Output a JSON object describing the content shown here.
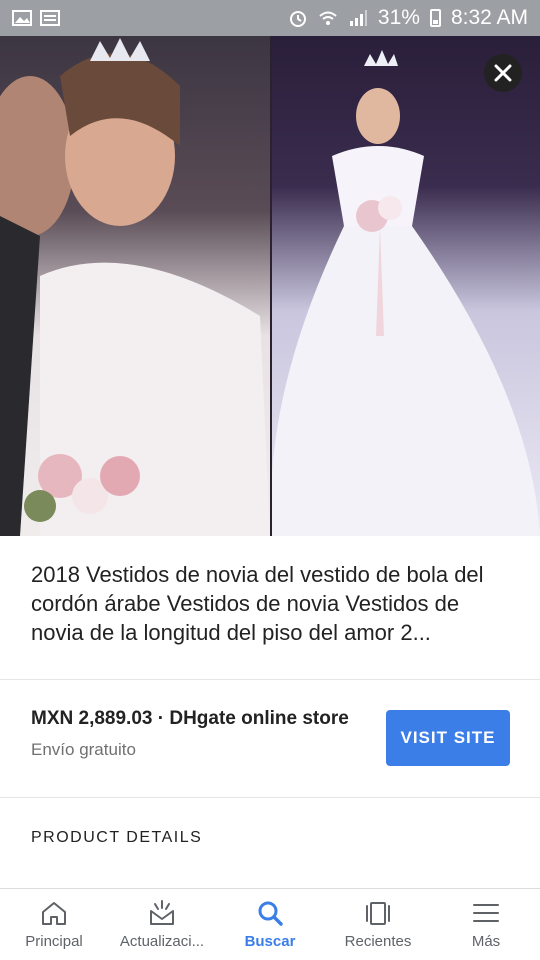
{
  "status_bar": {
    "battery": "31%",
    "time": "8:32 AM"
  },
  "result": {
    "title": "2018 Vestidos de novia del vestido de bola del cordón árabe Vestidos de novia Vestidos de novia de la longitud del piso del amor 2...",
    "price": "MXN 2,889.03",
    "separator": " · ",
    "store": "DHgate online store",
    "shipping": "Envío gratuito",
    "visit_button": "VISIT SITE"
  },
  "section": {
    "product_details": "PRODUCT DETAILS"
  },
  "bottom_nav": {
    "items": [
      {
        "label": "Principal",
        "icon": "home-icon"
      },
      {
        "label": "Actualizaci...",
        "icon": "updates-icon"
      },
      {
        "label": "Buscar",
        "icon": "search-icon",
        "active": true
      },
      {
        "label": "Recientes",
        "icon": "recent-icon"
      },
      {
        "label": "Más",
        "icon": "menu-icon"
      }
    ]
  },
  "colors": {
    "accent": "#3b7ee8",
    "status_bar": "#9c9fa3"
  }
}
